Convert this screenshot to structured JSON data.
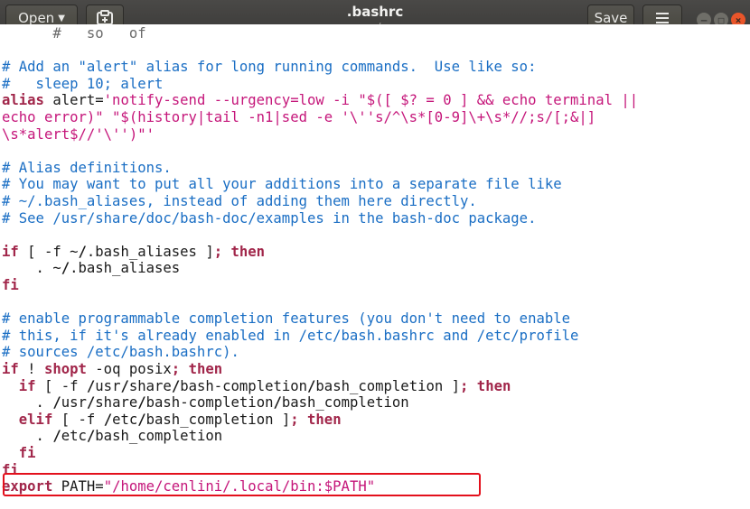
{
  "header": {
    "open_label": "Open",
    "title": ".bashrc",
    "subtitle": "~/",
    "save_label": "Save"
  },
  "icons": {
    "open_caret": "chevron-down-icon",
    "pin": "new-document-pin-icon",
    "menu": "hamburger-menu-icon",
    "minimize": "minimize-icon",
    "maximize": "maximize-icon",
    "close": "close-icon"
  },
  "colors": {
    "comment": "#1a6ec4",
    "keyword": "#a1264a",
    "string": "#c5167a",
    "highlight_border": "#e3101c"
  },
  "editor": {
    "lines": [
      [
        {
          "t": "p",
          "v": "      #   so   of"
        }
      ],
      [],
      [
        {
          "t": "c",
          "v": "# Add an \"alert\" alias for long running commands.  Use like so:"
        }
      ],
      [
        {
          "t": "c",
          "v": "#   sleep 10; alert"
        }
      ],
      [
        {
          "t": "k",
          "v": "alias"
        },
        {
          "t": "n",
          "v": " alert="
        },
        {
          "t": "s",
          "v": "'notify-send --urgency=low -i \"$([ $? = 0 ] && echo terminal ||"
        }
      ],
      [
        {
          "t": "s",
          "v": "echo error)\" \"$(history|tail -n1|sed -e '\\''s/^\\s*[0-9]\\+\\s*//;s/[;&|]"
        }
      ],
      [
        {
          "t": "s",
          "v": "\\s*alert$//'\\'')\"'"
        }
      ],
      [],
      [
        {
          "t": "c",
          "v": "# Alias definitions."
        }
      ],
      [
        {
          "t": "c",
          "v": "# You may want to put all your additions into a separate file like"
        }
      ],
      [
        {
          "t": "c",
          "v": "# ~/.bash_aliases, instead of adding them here directly."
        }
      ],
      [
        {
          "t": "c",
          "v": "# See /usr/share/doc/bash-doc/examples in the bash-doc package."
        }
      ],
      [],
      [
        {
          "t": "k",
          "v": "if"
        },
        {
          "t": "n",
          "v": " [ -f ~"
        },
        {
          "t": "b",
          "v": "/"
        },
        {
          "t": "n",
          "v": ".bash_aliases ]"
        },
        {
          "t": "k",
          "v": "; then"
        }
      ],
      [
        {
          "t": "n",
          "v": "    . ~"
        },
        {
          "t": "b",
          "v": "/"
        },
        {
          "t": "n",
          "v": ".bash_aliases"
        }
      ],
      [
        {
          "t": "k",
          "v": "fi"
        }
      ],
      [],
      [
        {
          "t": "c",
          "v": "# enable programmable completion features (you don't need to enable"
        }
      ],
      [
        {
          "t": "c",
          "v": "# this, if it's already enabled in /etc/bash.bashrc and /etc/profile"
        }
      ],
      [
        {
          "t": "c",
          "v": "# sources /etc/bash.bashrc)."
        }
      ],
      [
        {
          "t": "k",
          "v": "if"
        },
        {
          "t": "n",
          "v": " ! "
        },
        {
          "t": "k",
          "v": "shopt"
        },
        {
          "t": "n",
          "v": " -oq posix"
        },
        {
          "t": "k",
          "v": "; then"
        }
      ],
      [
        {
          "t": "n",
          "v": "  "
        },
        {
          "t": "k",
          "v": "if"
        },
        {
          "t": "n",
          "v": " [ -f "
        },
        {
          "t": "b",
          "v": "/"
        },
        {
          "t": "n",
          "v": "usr"
        },
        {
          "t": "b",
          "v": "/"
        },
        {
          "t": "n",
          "v": "share"
        },
        {
          "t": "b",
          "v": "/"
        },
        {
          "t": "n",
          "v": "bash-completion"
        },
        {
          "t": "b",
          "v": "/"
        },
        {
          "t": "n",
          "v": "bash_completion ]"
        },
        {
          "t": "k",
          "v": "; then"
        }
      ],
      [
        {
          "t": "n",
          "v": "    . "
        },
        {
          "t": "b",
          "v": "/"
        },
        {
          "t": "n",
          "v": "usr"
        },
        {
          "t": "b",
          "v": "/"
        },
        {
          "t": "n",
          "v": "share"
        },
        {
          "t": "b",
          "v": "/"
        },
        {
          "t": "n",
          "v": "bash-completion"
        },
        {
          "t": "b",
          "v": "/"
        },
        {
          "t": "n",
          "v": "bash_completion"
        }
      ],
      [
        {
          "t": "n",
          "v": "  "
        },
        {
          "t": "k",
          "v": "elif"
        },
        {
          "t": "n",
          "v": " [ -f "
        },
        {
          "t": "b",
          "v": "/"
        },
        {
          "t": "n",
          "v": "etc"
        },
        {
          "t": "b",
          "v": "/"
        },
        {
          "t": "n",
          "v": "bash_completion ]"
        },
        {
          "t": "k",
          "v": "; then"
        }
      ],
      [
        {
          "t": "n",
          "v": "    . "
        },
        {
          "t": "b",
          "v": "/"
        },
        {
          "t": "n",
          "v": "etc"
        },
        {
          "t": "b",
          "v": "/"
        },
        {
          "t": "n",
          "v": "bash_completion"
        }
      ],
      [
        {
          "t": "n",
          "v": "  "
        },
        {
          "t": "k",
          "v": "fi"
        }
      ],
      [
        {
          "t": "k",
          "v": "fi"
        }
      ],
      [
        {
          "t": "k",
          "v": "export"
        },
        {
          "t": "n",
          "v": " PATH="
        },
        {
          "t": "s",
          "v": "\"/home/cenlini/.local/bin:$PATH\""
        }
      ]
    ]
  }
}
